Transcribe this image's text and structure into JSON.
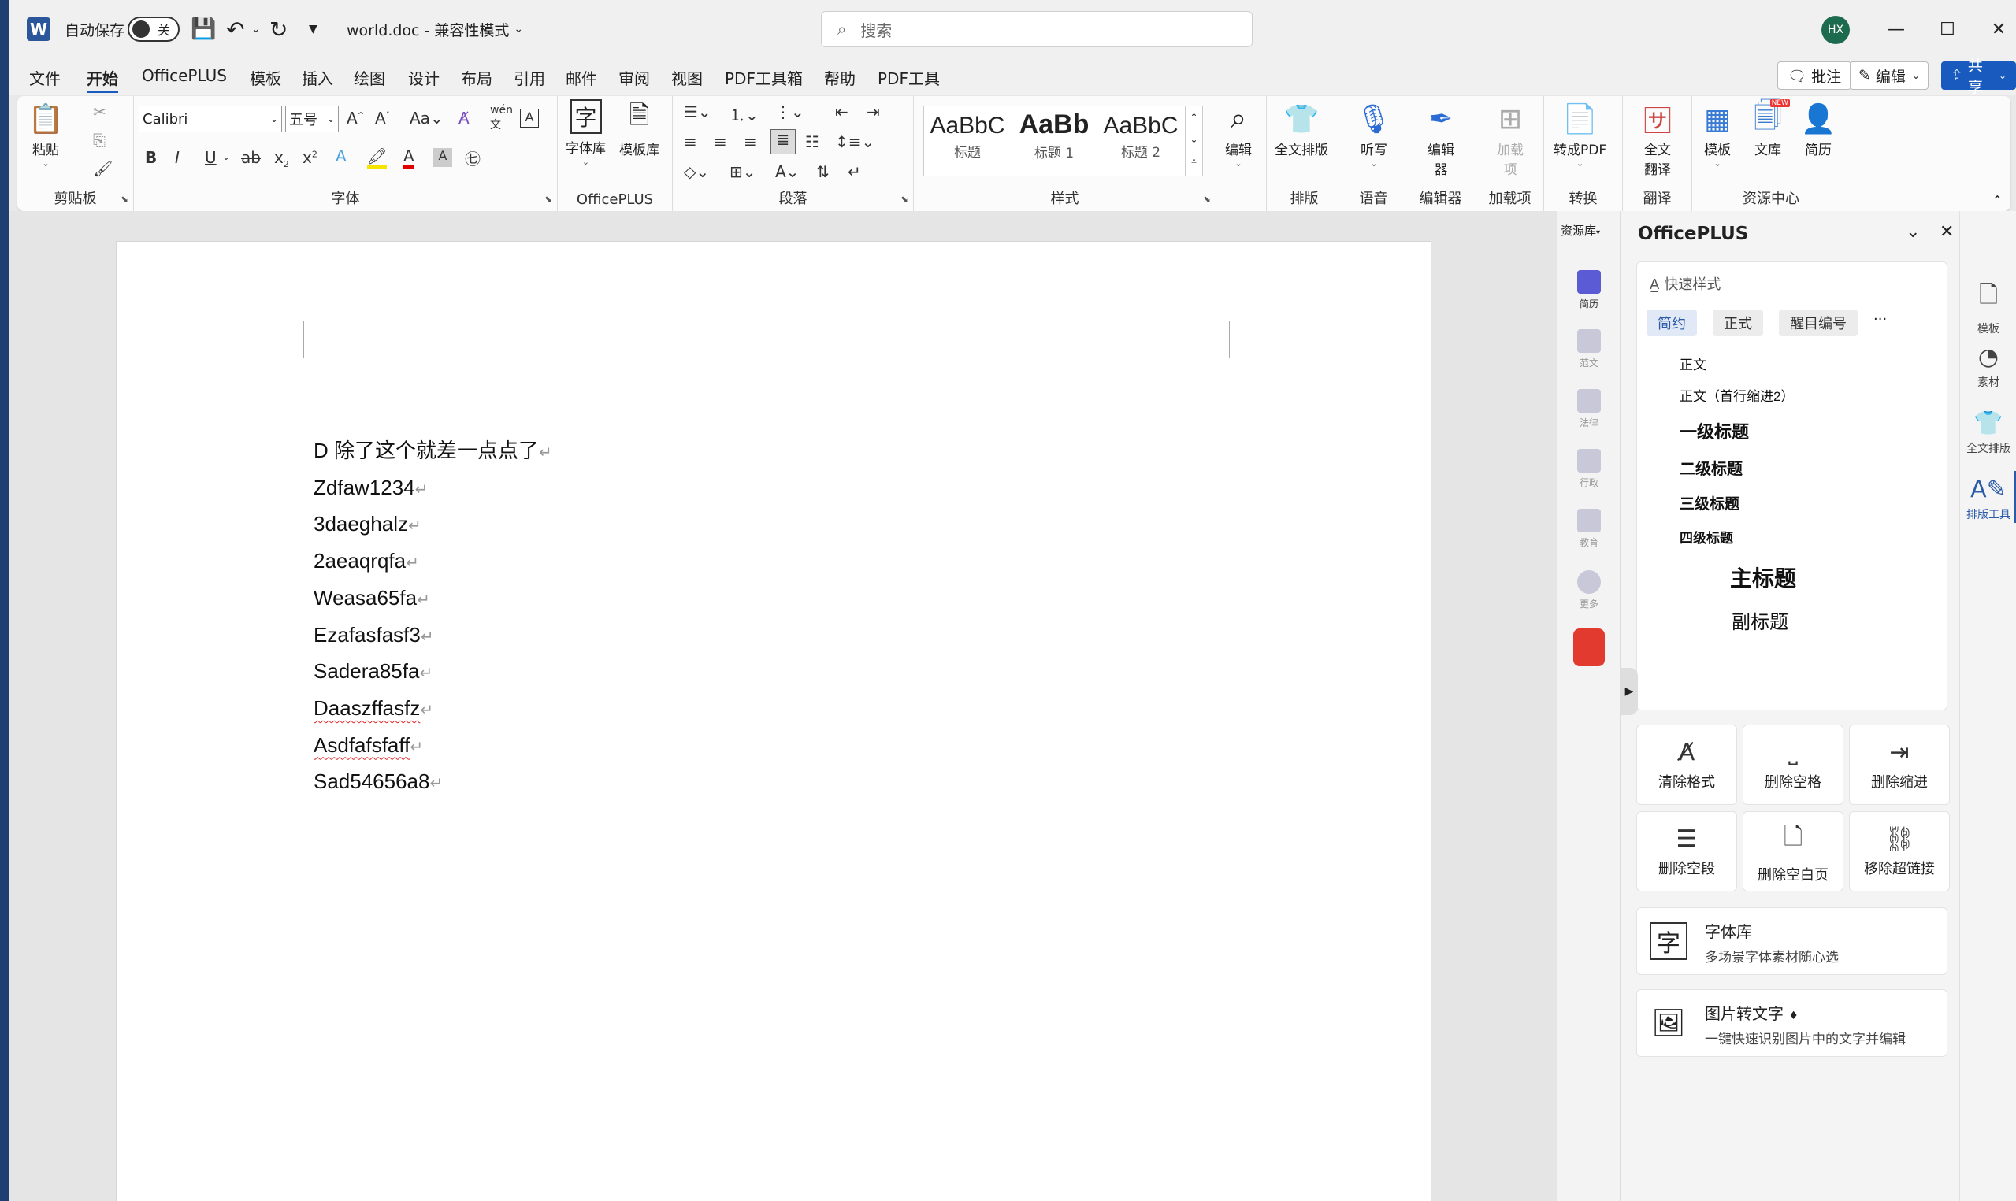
{
  "titlebar": {
    "autosave_label": "自动保存",
    "autosave_state": "关",
    "doc_title": "world.doc  -  兼容性模式",
    "search_placeholder": "搜索",
    "avatar_initials": "HX"
  },
  "menu": {
    "tabs": [
      "文件",
      "开始",
      "OfficePLUS",
      "模板",
      "插入",
      "绘图",
      "设计",
      "布局",
      "引用",
      "邮件",
      "审阅",
      "视图",
      "PDF工具箱",
      "帮助",
      "PDF工具"
    ],
    "active_tab": "开始",
    "comment_label": "批注",
    "edit_label": "编辑",
    "share_label": "共享"
  },
  "ribbon": {
    "clipboard": {
      "paste_label": "粘贴",
      "group_label": "剪贴板"
    },
    "font": {
      "font_name": "Calibri",
      "font_size": "五号",
      "group_label": "字体"
    },
    "officeplus": {
      "font_lib_label": "字体库",
      "template_lib_label": "模板库",
      "group_label": "OfficePLUS"
    },
    "paragraph": {
      "group_label": "段落"
    },
    "styles": {
      "items": [
        {
          "preview": "AaBbC",
          "name": "标题"
        },
        {
          "preview": "AaBb",
          "name": "标题 1"
        },
        {
          "preview": "AaBbC",
          "name": "标题 2"
        }
      ],
      "group_label": "样式"
    },
    "edit": {
      "label": "编辑"
    },
    "layout": {
      "btn_label": "全文排版",
      "group_label": "排版"
    },
    "voice": {
      "btn_label": "听写",
      "group_label": "语音"
    },
    "editor": {
      "btn_label": "编辑器",
      "group_label": "编辑器"
    },
    "addins": {
      "btn_label": "加载项",
      "group_label": "加载项"
    },
    "convert": {
      "btn_label": "转成PDF",
      "group_label": "转换"
    },
    "translate": {
      "btn_label": "全文翻译",
      "group_label": "翻译"
    },
    "resource": {
      "template_label": "模板",
      "library_label": "文库",
      "resume_label": "简历",
      "new_badge": "NEW",
      "group_label": "资源中心"
    }
  },
  "document": {
    "lines": [
      {
        "text": "D 除了这个就差一点点了",
        "spell": false
      },
      {
        "text": "Zdfaw1234",
        "spell": false
      },
      {
        "text": "3daeghalz",
        "spell": false
      },
      {
        "text": "2aeaqrqfa",
        "spell": false
      },
      {
        "text": "Weasa65fa",
        "spell": false
      },
      {
        "text": "Ezafasfasf3",
        "spell": false
      },
      {
        "text": "Sadera85fa",
        "spell": false
      },
      {
        "text": "Daaszffasfz",
        "spell": true
      },
      {
        "text": "Asdfafsfaff",
        "spell": true
      },
      {
        "text": "Sad54656a8",
        "spell": false
      }
    ],
    "para_mark": "↵"
  },
  "resource_strip": {
    "title": "资源库",
    "items": [
      "简历",
      "范文",
      "法律",
      "行政",
      "教育",
      "更多"
    ]
  },
  "panel": {
    "title": "OfficePLUS",
    "quick_style_header": "快速样式",
    "tabs": [
      "简约",
      "正式",
      "醒目编号"
    ],
    "more": "···",
    "styles": [
      "正文",
      "正文（首行缩进2）",
      "一级标题",
      "二级标题",
      "三级标题",
      "四级标题",
      "主标题",
      "副标题"
    ],
    "tools": [
      "清除格式",
      "删除空格",
      "删除缩进",
      "删除空段",
      "删除空白页",
      "移除超链接"
    ],
    "features": [
      {
        "title": "字体库",
        "desc": "多场景字体素材随心选"
      },
      {
        "title": "图片转文字",
        "desc": "一键快速识别图片中的文字并编辑"
      }
    ]
  },
  "rail": {
    "items": [
      "模板",
      "素材",
      "全文排版",
      "排版工具"
    ]
  }
}
